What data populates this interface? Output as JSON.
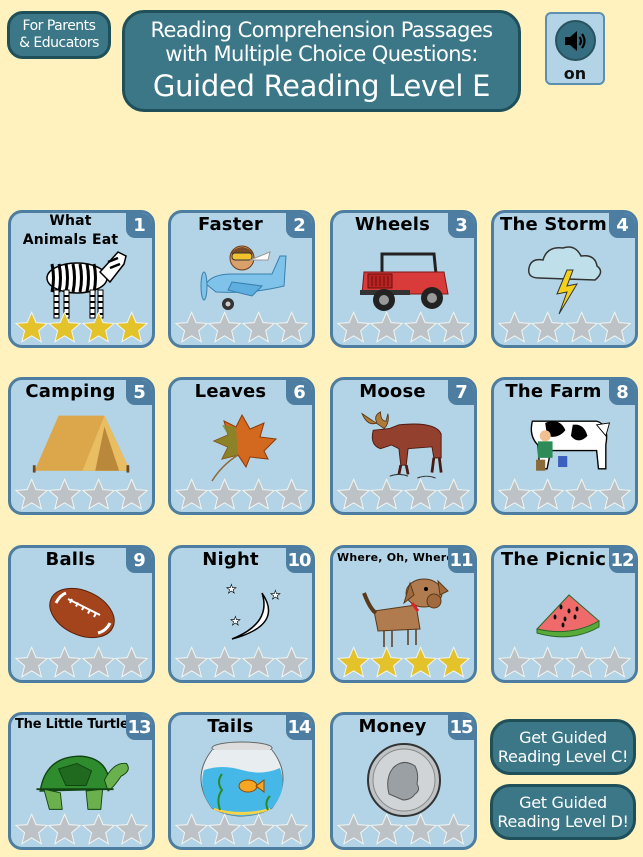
{
  "header": {
    "parents_button": [
      "For Parents",
      "& Educators"
    ],
    "title_lines": [
      "Reading Comprehension Passages",
      "with Multiple Choice Questions:",
      "Guided Reading Level E"
    ],
    "sound": {
      "icon": "speaker-icon",
      "state": "on"
    }
  },
  "colors": {
    "background": "#fff2bf",
    "teal": "#3b7787",
    "card_bg": "#b3d4e6",
    "card_border": "#4d7ea1",
    "star_earned": "#e3c22a",
    "star_empty": "#bcc2c6"
  },
  "stories": [
    {
      "number": "1",
      "title": "What Animals Eat",
      "image": "zebra",
      "stars_earned": 4,
      "stars_total": 4
    },
    {
      "number": "2",
      "title": "Faster",
      "image": "airplane-pilot",
      "stars_earned": 0,
      "stars_total": 4
    },
    {
      "number": "3",
      "title": "Wheels",
      "image": "red-jeep",
      "stars_earned": 0,
      "stars_total": 4
    },
    {
      "number": "4",
      "title": "The Storm",
      "image": "storm-cloud",
      "stars_earned": 0,
      "stars_total": 4
    },
    {
      "number": "5",
      "title": "Camping",
      "image": "tent",
      "stars_earned": 0,
      "stars_total": 4
    },
    {
      "number": "6",
      "title": "Leaves",
      "image": "maple-leaf",
      "stars_earned": 0,
      "stars_total": 4
    },
    {
      "number": "7",
      "title": "Moose",
      "image": "moose",
      "stars_earned": 0,
      "stars_total": 4
    },
    {
      "number": "8",
      "title": "The Farm",
      "image": "farmer-milking-cow",
      "stars_earned": 0,
      "stars_total": 4
    },
    {
      "number": "9",
      "title": "Balls",
      "image": "football",
      "stars_earned": 0,
      "stars_total": 4
    },
    {
      "number": "10",
      "title": "Night",
      "image": "moon-stars",
      "stars_earned": 0,
      "stars_total": 4
    },
    {
      "number": "11",
      "title": "Where, Oh, Where?",
      "image": "dog",
      "stars_earned": 4,
      "stars_total": 4
    },
    {
      "number": "12",
      "title": "The Picnic",
      "image": "watermelon",
      "stars_earned": 0,
      "stars_total": 4
    },
    {
      "number": "13",
      "title": "The Little Turtle",
      "image": "turtle",
      "stars_earned": 0,
      "stars_total": 4
    },
    {
      "number": "14",
      "title": "Tails",
      "image": "fishbowl",
      "stars_earned": 0,
      "stars_total": 4
    },
    {
      "number": "15",
      "title": "Money",
      "image": "dime",
      "stars_earned": 0,
      "stars_total": 4
    }
  ],
  "promo_buttons": [
    {
      "lines": [
        "Get Guided",
        "Reading Level C!"
      ]
    },
    {
      "lines": [
        "Get Guided",
        "Reading Level D!"
      ]
    }
  ]
}
